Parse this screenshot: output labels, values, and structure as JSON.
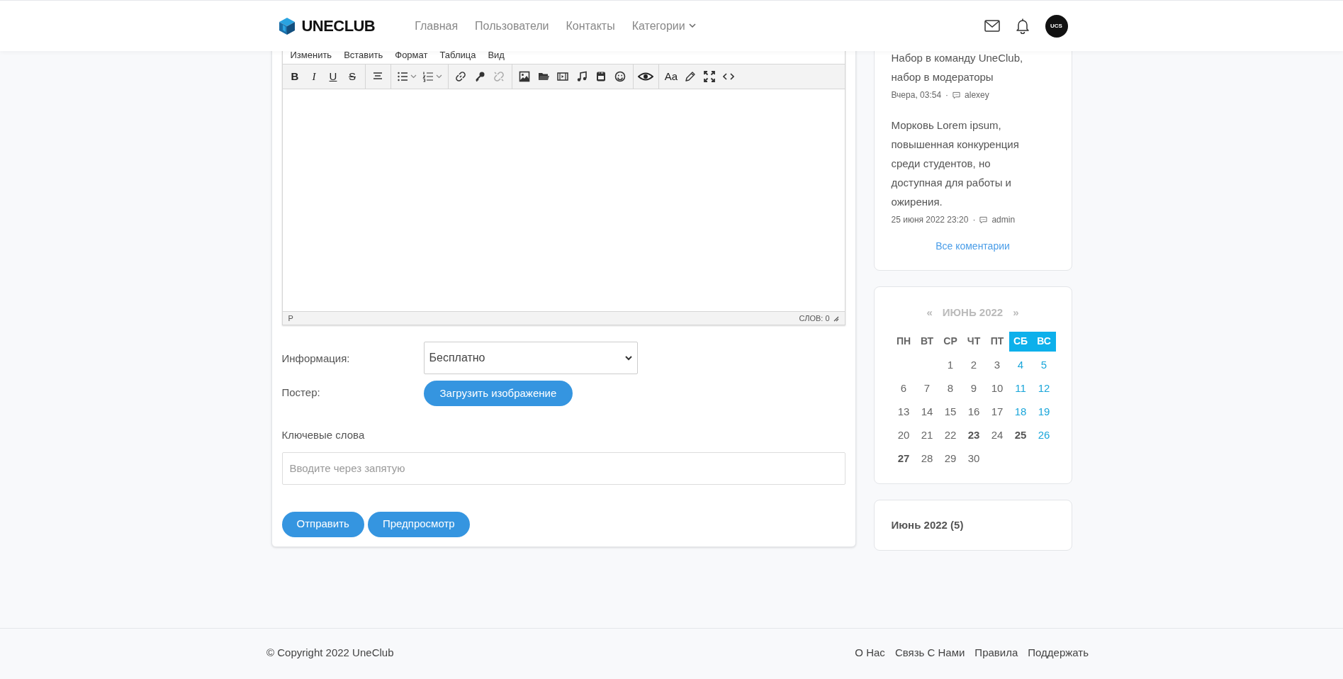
{
  "header": {
    "logo": "UNECLUB",
    "nav": [
      {
        "label": "Главная",
        "dropdown": false
      },
      {
        "label": "Пользователи",
        "dropdown": false
      },
      {
        "label": "Контакты",
        "dropdown": false
      },
      {
        "label": "Категории",
        "dropdown": true
      }
    ],
    "avatar": "UCS"
  },
  "editor": {
    "menu": [
      "Изменить",
      "Вставить",
      "Формат",
      "Таблица",
      "Вид"
    ],
    "toolbar_text": [
      "B",
      "I",
      "U",
      "S",
      "Aa"
    ],
    "path": "P",
    "word_count": "СЛОВ: 0"
  },
  "form": {
    "info_label": "Информация:",
    "info_value": "Бесплатно",
    "poster_label": "Постер:",
    "upload_button": "Загрузить изображение",
    "keywords_label": "Ключевые слова",
    "keywords_placeholder": "Вводите через запятую",
    "buttons": [
      "Отправить",
      "Предпросмотр"
    ]
  },
  "comments": {
    "items": [
      {
        "text": "Набор в команду UneClub, набор в модераторы",
        "date": "Вчера, 03:54",
        "separator": "·",
        "author": "alexey"
      },
      {
        "text": "Морковь Lorem ipsum, повышенная конкуренция среди студентов, но доступная для работы и ожирения.",
        "date": "25 июня 2022 23:20",
        "separator": "·",
        "author": "admin"
      }
    ],
    "all_link": "Все коментарии"
  },
  "calendar": {
    "prev": "«",
    "title": "ИЮНЬ 2022",
    "next": "»",
    "weekdays": [
      {
        "label": "ПН",
        "weekend": false
      },
      {
        "label": "ВТ",
        "weekend": false
      },
      {
        "label": "СР",
        "weekend": false
      },
      {
        "label": "ЧТ",
        "weekend": false
      },
      {
        "label": "ПТ",
        "weekend": false
      },
      {
        "label": "СБ",
        "weekend": true
      },
      {
        "label": "ВС",
        "weekend": true
      }
    ],
    "weeks": [
      {
        "kind": "first",
        "days": [
          {
            "day": "1",
            "has_posts": false
          },
          {
            "day": "2",
            "has_posts": false
          },
          {
            "day": "3",
            "has_posts": false
          },
          {
            "day": "4",
            "has_posts": false
          },
          {
            "day": "5",
            "has_posts": false
          }
        ]
      },
      {
        "kind": "full",
        "days": [
          {
            "day": "6",
            "has_posts": false
          },
          {
            "day": "7",
            "has_posts": false
          },
          {
            "day": "8",
            "has_posts": false
          },
          {
            "day": "9",
            "has_posts": false
          },
          {
            "day": "10",
            "has_posts": false
          },
          {
            "day": "11",
            "has_posts": false
          },
          {
            "day": "12",
            "has_posts": false
          }
        ]
      },
      {
        "kind": "full",
        "days": [
          {
            "day": "13",
            "has_posts": false
          },
          {
            "day": "14",
            "has_posts": false
          },
          {
            "day": "15",
            "has_posts": false
          },
          {
            "day": "16",
            "has_posts": false
          },
          {
            "day": "17",
            "has_posts": false
          },
          {
            "day": "18",
            "has_posts": false
          },
          {
            "day": "19",
            "has_posts": false
          }
        ]
      },
      {
        "kind": "full",
        "days": [
          {
            "day": "20",
            "has_posts": false
          },
          {
            "day": "21",
            "has_posts": false
          },
          {
            "day": "22",
            "has_posts": false
          },
          {
            "day": "23",
            "has_posts": true
          },
          {
            "day": "24",
            "has_posts": false
          },
          {
            "day": "25",
            "has_posts": true
          },
          {
            "day": "26",
            "has_posts": false
          }
        ]
      },
      {
        "kind": "last",
        "days": [
          {
            "day": "27",
            "has_posts": true
          },
          {
            "day": "28",
            "has_posts": false
          },
          {
            "day": "29",
            "has_posts": false
          },
          {
            "day": "30",
            "has_posts": false
          }
        ]
      }
    ]
  },
  "archive": [
    {
      "label": "Июнь 2022 (5)"
    }
  ],
  "footer": {
    "copyright": "© Copyright 2022 UneClub",
    "links": [
      "О Нас",
      "Связь С Нами",
      "Правила",
      "Поддержать"
    ]
  }
}
